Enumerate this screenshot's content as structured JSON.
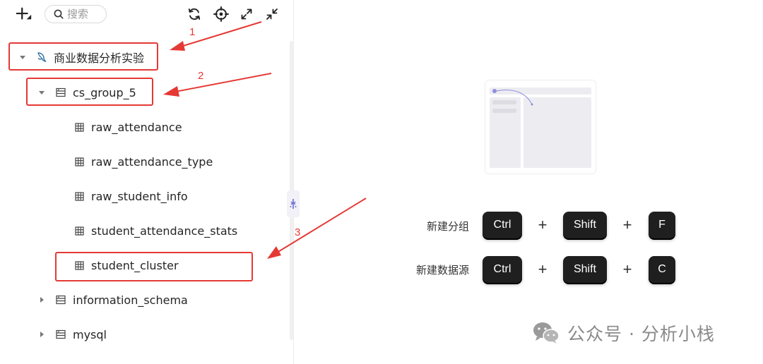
{
  "toolbar": {
    "add_icon": "plus-icon",
    "search_placeholder": "搜索",
    "icons": [
      "refresh-icon",
      "locate-icon",
      "expand-icon",
      "collapse-icon"
    ]
  },
  "tree": {
    "root": {
      "label": "商业数据分析实验",
      "icon": "mysql-dolphin-icon"
    },
    "databases": [
      {
        "label": "cs_group_5",
        "expanded": true
      },
      {
        "label": "information_schema",
        "expanded": false
      },
      {
        "label": "mysql",
        "expanded": false
      }
    ],
    "tables": [
      {
        "label": "raw_attendance"
      },
      {
        "label": "raw_attendance_type"
      },
      {
        "label": "raw_student_info"
      },
      {
        "label": "student_attendance_stats"
      },
      {
        "label": "student_cluster"
      }
    ]
  },
  "annotations": {
    "n1": "1",
    "n2": "2",
    "n3": "3",
    "color": "#e53935"
  },
  "shortcuts": {
    "new_group": {
      "label": "新建分组",
      "keys": [
        "Ctrl",
        "Shift",
        "F"
      ]
    },
    "new_datasource": {
      "label": "新建数据源",
      "keys": [
        "Ctrl",
        "Shift",
        "C"
      ]
    },
    "plus": "+"
  },
  "watermark": {
    "text": "公众号 · 分析小栈",
    "icon": "wechat-icon"
  },
  "colors": {
    "accent": "#6b6bd6",
    "key_bg": "#1f1f1f",
    "annotation": "#e53935"
  }
}
